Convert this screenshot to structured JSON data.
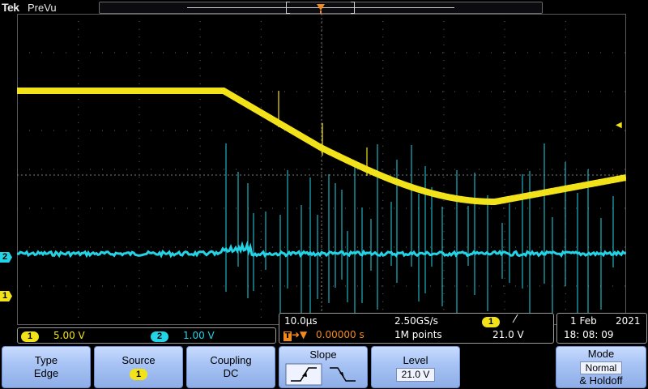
{
  "header": {
    "brand": "Tek",
    "mode": "PreVu"
  },
  "trigger": {
    "marker": "T",
    "level_arrow": "◀"
  },
  "channels": [
    {
      "id": "1",
      "marker": "1",
      "scale": "5.00 V",
      "color": "#f2e21a"
    },
    {
      "id": "2",
      "marker": "2",
      "scale": "1.00 V",
      "color": "#25d3e6"
    }
  ],
  "horizontal": {
    "timebase": "10.0µs",
    "sample_rate": "2.50GS/s",
    "record_length": "1M points",
    "delay": "0.00000 s",
    "trigger_source": "1",
    "trigger_slope": "⁄",
    "trigger_level": "21.0 V"
  },
  "datetime": {
    "date": "1 Feb",
    "year": "2021",
    "time": "18: 08: 09"
  },
  "menu": {
    "type": {
      "label": "Type",
      "value": "Edge"
    },
    "source": {
      "label": "Source",
      "value": "1"
    },
    "coupling": {
      "label": "Coupling",
      "value": "DC"
    },
    "slope": {
      "label": "Slope"
    },
    "level": {
      "label": "Level",
      "value": "21.0 V"
    },
    "mode": {
      "label": "Mode",
      "value": "Normal",
      "value2": "& Holdoff"
    }
  }
}
